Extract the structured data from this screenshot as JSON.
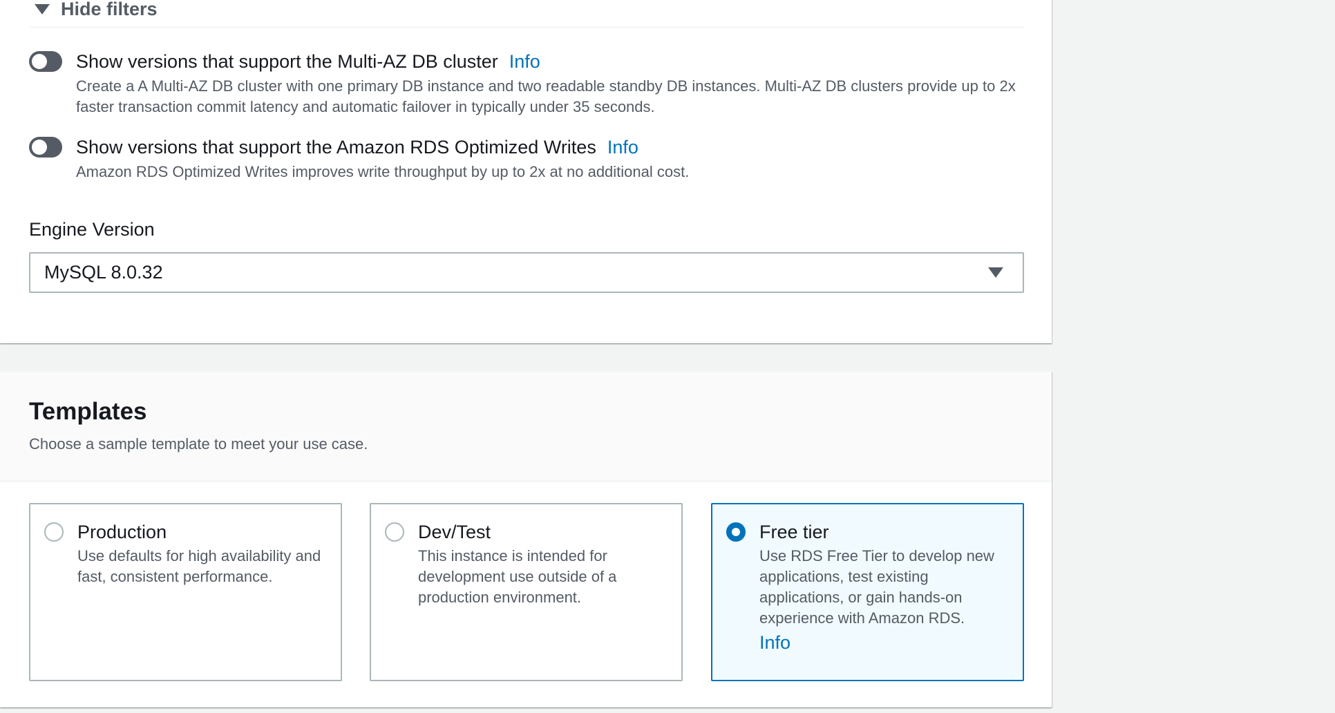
{
  "engine_panel": {
    "filters_toggle_label": "Hide filters",
    "filters": [
      {
        "label": "Show versions that support the Multi-AZ DB cluster",
        "info": "Info",
        "description": "Create a A Multi-AZ DB cluster with one primary DB instance and two readable standby DB instances. Multi-AZ DB clusters provide up to 2x faster transaction commit latency and automatic failover in typically under 35 seconds.",
        "enabled": false
      },
      {
        "label": "Show versions that support the Amazon RDS Optimized Writes",
        "info": "Info",
        "description": "Amazon RDS Optimized Writes improves write throughput by up to 2x at no additional cost.",
        "enabled": false
      }
    ],
    "engine_version_label": "Engine Version",
    "engine_version_value": "MySQL 8.0.32"
  },
  "templates": {
    "title": "Templates",
    "subtitle": "Choose a sample template to meet your use case.",
    "options": [
      {
        "title": "Production",
        "description": "Use defaults for high availability and fast, consistent performance.",
        "selected": false
      },
      {
        "title": "Dev/Test",
        "description": "This instance is intended for development use outside of a production environment.",
        "selected": false
      },
      {
        "title": "Free tier",
        "description": "Use RDS Free Tier to develop new applications, test existing applications, or gain hands-on experience with Amazon RDS.",
        "info": "Info",
        "selected": true
      }
    ]
  },
  "colors": {
    "accent": "#0073bb",
    "toggle_off": "#545b64",
    "border": "#aab7b8",
    "page_background": "#f2f3f3"
  },
  "icons": {
    "filters_toggle": "caret-down-icon",
    "select_caret": "caret-down-icon"
  }
}
